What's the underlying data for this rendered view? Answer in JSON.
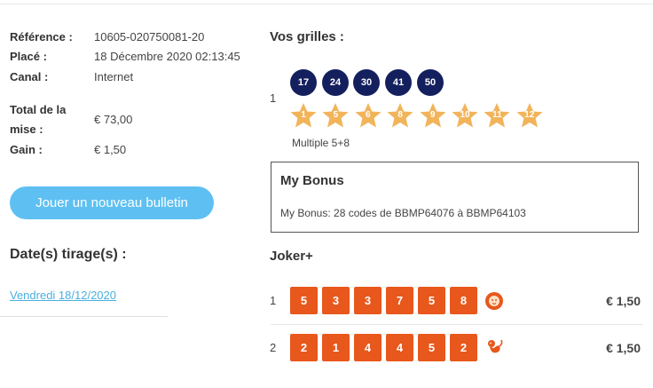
{
  "ticket": {
    "reference_label": "Référence :",
    "reference_value": "10605-020750081-20",
    "placed_label": "Placé :",
    "placed_value": "18 Décembre 2020 02:13:45",
    "channel_label": "Canal :",
    "channel_value": "Internet",
    "total_label_line1": "Total de la",
    "total_label_line2": "mise :",
    "total_value": "€ 73,00",
    "gain_label": "Gain :",
    "gain_value": "€ 1,50"
  },
  "actions": {
    "play_button_label": "Jouer un nouveau bulletin"
  },
  "draws": {
    "title": "Date(s) tirage(s) :",
    "dates": [
      "Vendredi 18/12/2020"
    ]
  },
  "grids": {
    "title": "Vos grilles :",
    "items": [
      {
        "index": "1",
        "numbers": [
          "17",
          "24",
          "30",
          "41",
          "50"
        ],
        "stars": [
          "1",
          "5",
          "6",
          "8",
          "9",
          "10",
          "11",
          "12"
        ],
        "type": "Multiple 5+8"
      }
    ]
  },
  "bonus": {
    "title": "My Bonus",
    "text": "My Bonus: 28 codes de BBMP64076 à BBMP64103"
  },
  "joker": {
    "title": "Joker+",
    "rows": [
      {
        "index": "1",
        "digits": [
          "5",
          "3",
          "3",
          "7",
          "5",
          "8"
        ],
        "icon": "lion-icon",
        "amount": "€ 1,50"
      },
      {
        "index": "2",
        "digits": [
          "2",
          "1",
          "4",
          "4",
          "5",
          "2"
        ],
        "icon": "monkey-icon",
        "amount": "€ 1,50"
      }
    ]
  },
  "colors": {
    "ball": "#14205e",
    "star": "#f2b45a",
    "joker": "#e8571c",
    "button": "#5ec0f2",
    "link": "#4ab0e0"
  }
}
